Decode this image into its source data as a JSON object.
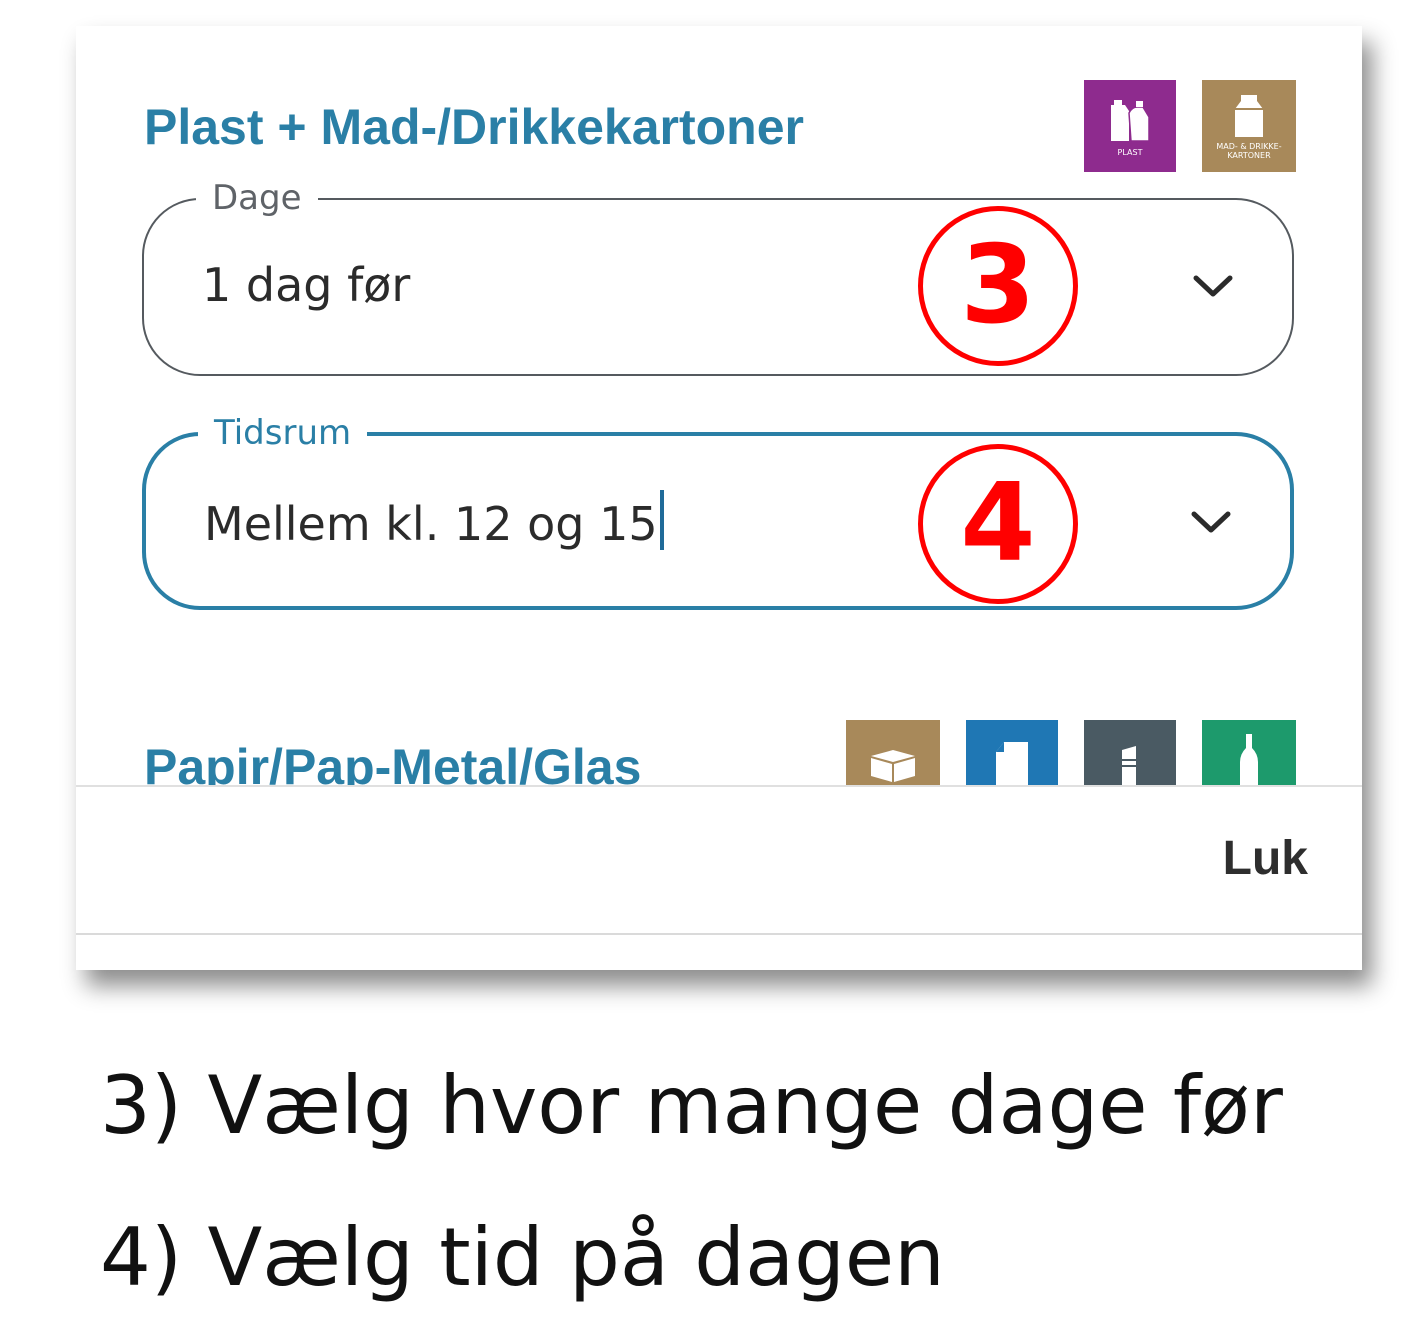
{
  "sections": {
    "plast": {
      "title": "Plast + Mad-/Drikkekartoner",
      "badges": [
        {
          "icon": "plastic-bottles-icon",
          "label": "PLAST",
          "color": "#8e2b8e"
        },
        {
          "icon": "milk-carton-icon",
          "label_line1": "MAD- & DRIKKE-",
          "label_line2": "KARTONER",
          "color": "#a8895a"
        }
      ]
    },
    "papir": {
      "title": "Papir/Pap-Metal/Glas",
      "badges": [
        {
          "icon": "cardboard-box-icon",
          "color": "#a8895a"
        },
        {
          "icon": "paper-sheets-icon",
          "color": "#1f77b4"
        },
        {
          "icon": "metal-can-icon",
          "color": "#4a5a63"
        },
        {
          "icon": "glass-bottle-icon",
          "color": "#1d9a6c"
        }
      ]
    }
  },
  "fields": {
    "dage": {
      "label": "Dage",
      "value": "1 dag før"
    },
    "tidsrum": {
      "label": "Tidsrum",
      "value": "Mellem kl. 12 og 15"
    }
  },
  "annotations": {
    "step3": "3",
    "step4": "4"
  },
  "footer": {
    "close_label": "Luk"
  },
  "captions": {
    "line1": "3) Vælg hvor mange dage før",
    "line2": "4) Vælg tid på dagen"
  },
  "colors": {
    "accent": "#2a7fa6",
    "annotation_red": "#ff0000",
    "text": "#2b2b2b"
  }
}
